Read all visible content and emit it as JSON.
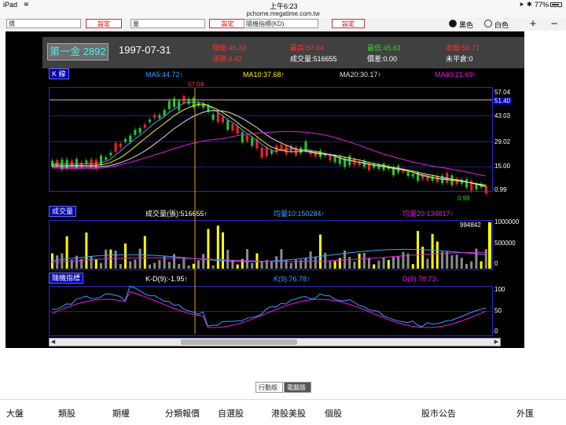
{
  "status_bar": {
    "device": "iPad",
    "time": "上午6:23",
    "battery": "77%"
  },
  "url": "pchome.megatime.com.tw",
  "controls": {
    "select1": "價",
    "button1": "設定",
    "select2": "量",
    "button2": "設定",
    "select3": "隨機指標(KD)",
    "button3": "設定",
    "theme_black": "黑色",
    "theme_white": "白色",
    "zoom_in": "+",
    "zoom_out": "−"
  },
  "header": {
    "name": "第一金 2892",
    "date": "1997-07-31",
    "open": "開盤:46.33",
    "change": "漲跌:4.62",
    "high": "最高:57.04",
    "volume": "成交量:516655",
    "low": "最低:45.61",
    "diff": "價差:0.00",
    "close": "收盤:50.71",
    "unsettled": "未平倉:0"
  },
  "kline": {
    "tag": "K 線",
    "ma5": "MA5:44.72↑",
    "ma10": "MA10:37.68↑",
    "ma20": "MA20:30.17↑",
    "ma60": "MA60:21.69↑",
    "peak_label": "57.04",
    "low_label": "0.99",
    "axis": [
      "57.04",
      "51.40",
      "43.03",
      "29.02",
      "15.00",
      "0.99"
    ]
  },
  "volume": {
    "tag": "成交量",
    "vol": "成交量(張):516655↑",
    "avg10": "均量10:150284↑",
    "avg20": "均量20:134817↑",
    "max_label": "994842",
    "axis": [
      "1000000",
      "500000",
      "0"
    ]
  },
  "kd": {
    "tag": "隨機指標",
    "kd": "K-D(9):-1.95↑",
    "k": "K(9):76.78↑",
    "d": "D(9):78.73↓",
    "axis": [
      "100",
      "50",
      "0"
    ]
  },
  "version": {
    "mobile": "行動版",
    "desktop": "電腦版"
  },
  "nav": [
    "大盤",
    "類股",
    "期權",
    "分類報價",
    "自選股",
    "港股美股",
    "個股",
    "股市公告",
    "外匯"
  ],
  "colors": {
    "ma5": "#3aa0ff",
    "ma10": "#ffee00",
    "ma20": "#e0e0e0",
    "ma60": "#e020e0",
    "grid": "#1e1e8c"
  }
}
